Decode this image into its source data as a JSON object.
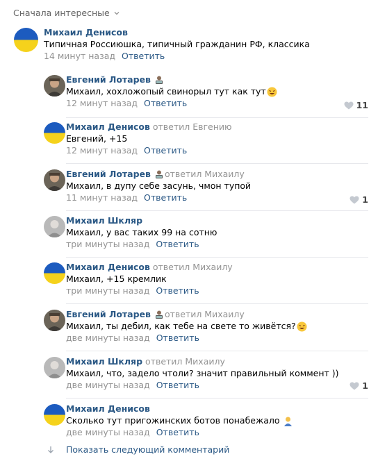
{
  "sort": {
    "label": "Сначала интересные"
  },
  "comments": [
    {
      "author": "Михаил Денисов",
      "text": "Типичная Россиюшка, типичный гражданин РФ, классика",
      "time": "14 минут назад",
      "reply": "Ответить"
    },
    {
      "author": "Евгений Лотарев",
      "text": "Михаил, хохложопый свинорыл тут как тут",
      "time": "12 минут назад",
      "reply": "Ответить",
      "likes": "11"
    },
    {
      "author": "Михаил Денисов",
      "replied": "ответил Евгению",
      "text": "Евгений, +15",
      "time": "12 минут назад",
      "reply": "Ответить"
    },
    {
      "author": "Евгений Лотарев",
      "replied": "ответил Михаилу",
      "text": "Михаил, в дупу себе засунь, чмон тупой",
      "time": "11 минут назад",
      "reply": "Ответить",
      "likes": "1"
    },
    {
      "author": "Михаил Шкляр",
      "text": "Михаил, у вас таких 99 на сотню",
      "time": "три минуты назад",
      "reply": "Ответить"
    },
    {
      "author": "Михаил Денисов",
      "replied": "ответил Михаилу",
      "text": "Михаил, +15 кремлик",
      "time": "три минуты назад",
      "reply": "Ответить"
    },
    {
      "author": "Евгений Лотарев",
      "replied": "ответил Михаилу",
      "text": "Михаил, ты дебил, как тебе на свете то живётся?",
      "time": "две минуты назад",
      "reply": "Ответить"
    },
    {
      "author": "Михаил Шкляр",
      "replied": "ответил Михаилу",
      "text": "Михаил, что, задело чтоли? значит правильный коммент ))",
      "time": "две минуты назад",
      "reply": "Ответить",
      "likes": "1"
    },
    {
      "author": "Михаил Денисов",
      "text": "Сколько тут пригожинских ботов понабежало",
      "time": "две минуты назад",
      "reply": "Ответить"
    }
  ],
  "more": {
    "label": "Показать следующий комментарий"
  },
  "colors": {
    "link": "#2a5885",
    "muted": "#939393",
    "flag_blue": "#1c5bbf",
    "flag_yellow": "#f5d21c"
  },
  "icons": {
    "sort": "chevron-down-icon",
    "like": "heart-icon",
    "more": "arrow-down-icon"
  }
}
